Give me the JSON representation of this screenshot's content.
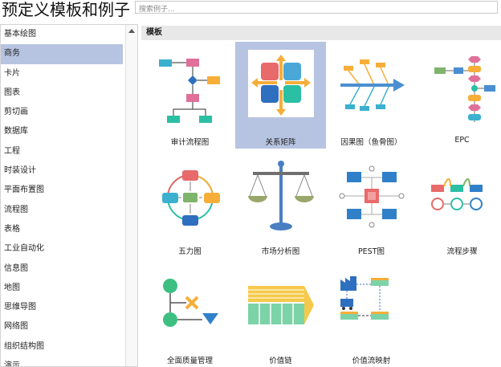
{
  "page_title": "预定义模板和例子",
  "search": {
    "placeholder": "搜索例子..."
  },
  "sidebar": {
    "categories": [
      "基本绘图",
      "商务",
      "卡片",
      "图表",
      "剪切画",
      "数据库",
      "工程",
      "时装设计",
      "平面布置图",
      "流程图",
      "表格",
      "工业自动化",
      "信息图",
      "地图",
      "思维导图",
      "网络图",
      "组织结构图",
      "演示"
    ],
    "selected_index": 1
  },
  "main": {
    "section_title": "模板",
    "templates": [
      {
        "label": "审计流程图",
        "icon": "audit-flowchart-icon"
      },
      {
        "label": "关系矩阵",
        "icon": "relationship-matrix-icon",
        "selected": true
      },
      {
        "label": "因果图（鱼骨图）",
        "icon": "fishbone-icon"
      },
      {
        "label": "EPC",
        "icon": "epc-icon"
      },
      {
        "label": "五力图",
        "icon": "five-forces-icon"
      },
      {
        "label": "市场分析图",
        "icon": "balance-scale-icon"
      },
      {
        "label": "PEST图",
        "icon": "pest-icon"
      },
      {
        "label": "流程步骤",
        "icon": "process-steps-icon"
      },
      {
        "label": "全面质量管理",
        "icon": "tqm-icon"
      },
      {
        "label": "价值链",
        "icon": "value-chain-icon"
      },
      {
        "label": "价值流映射",
        "icon": "value-stream-icon"
      }
    ]
  },
  "colors": {
    "selection": "#b7c4e1",
    "teal": "#2bbfa4",
    "blue": "#4a8fd1",
    "pink": "#e0709a",
    "orange": "#f6ae39"
  }
}
